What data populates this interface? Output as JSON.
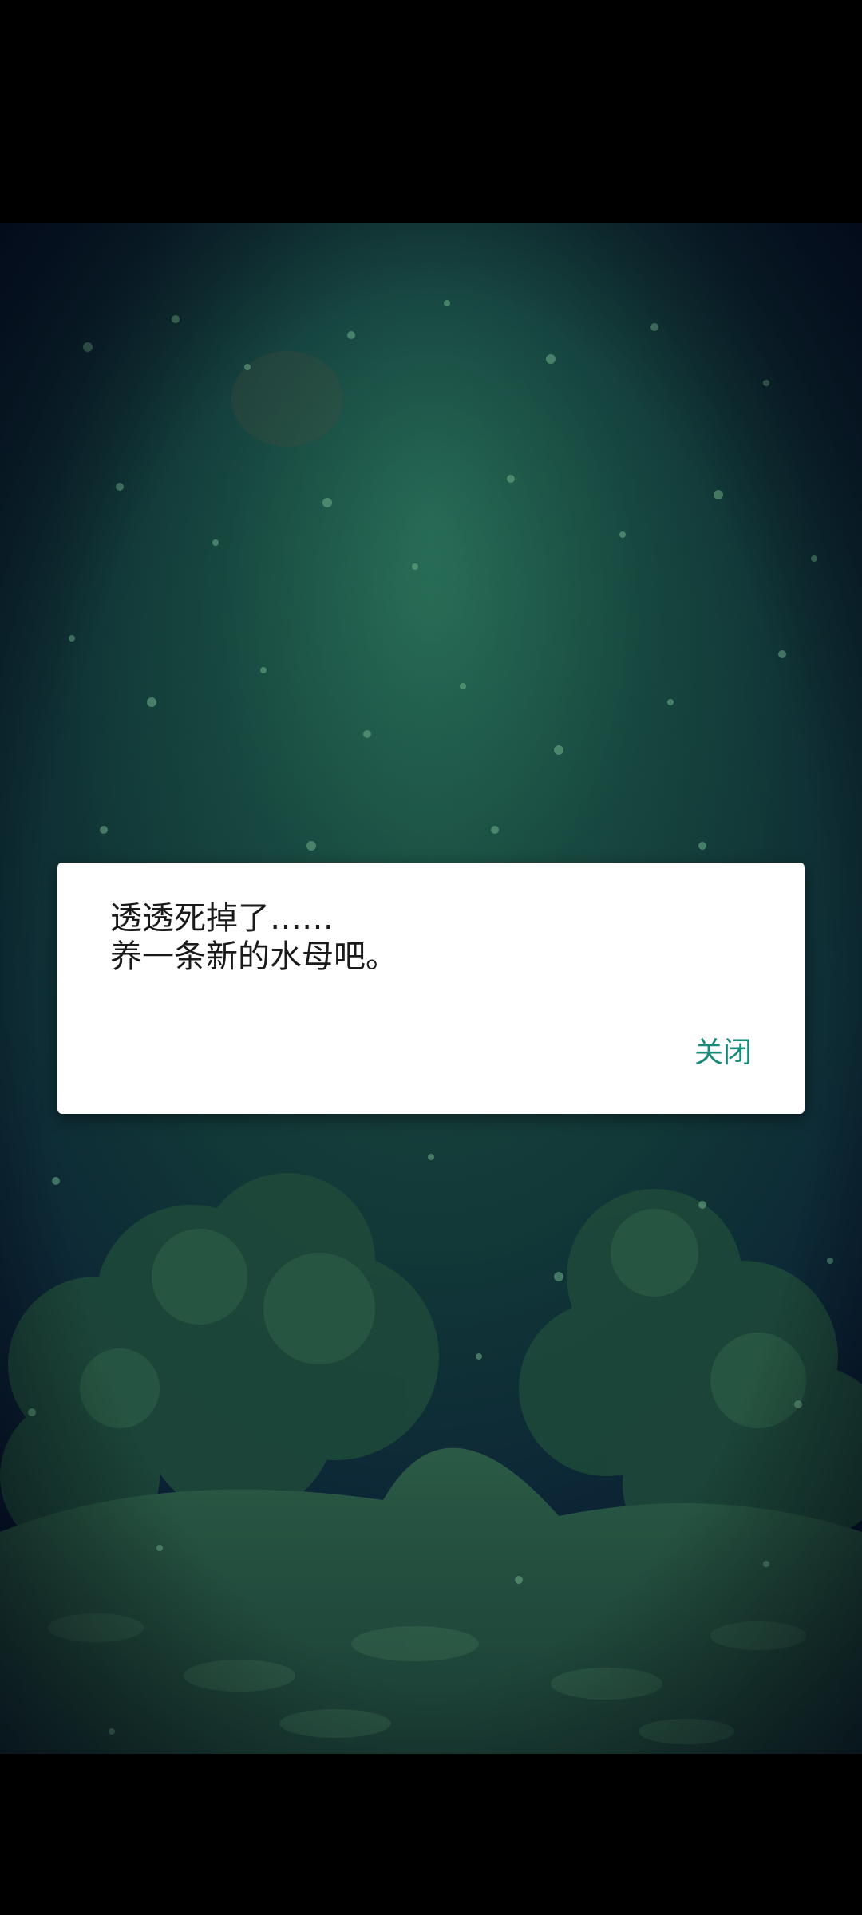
{
  "dialog": {
    "message_line1": "透透死掉了……",
    "message_line2": "养一条新的水母吧。",
    "close_label": "关闭"
  },
  "colors": {
    "accent": "#1a8a78",
    "water_top": "#1b4a42",
    "water_bottom": "#07142a"
  }
}
